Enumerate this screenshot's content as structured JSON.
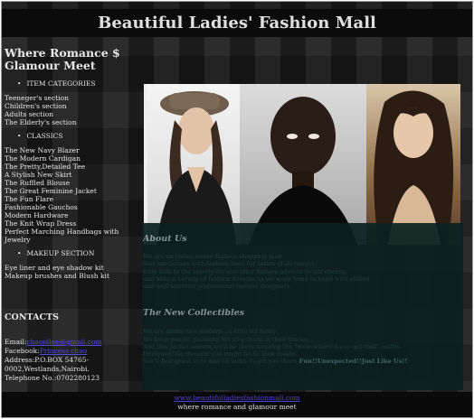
{
  "header": {
    "title": "Beautiful Ladies' Fashion Mall"
  },
  "sidebar": {
    "tagline": "Where Romance $ Glamour Meet",
    "item_categories": {
      "title": "ITEM CATEGORIES",
      "items": [
        "Teeneger's section",
        "Children's section",
        "Adults section",
        "The Elderly's section"
      ]
    },
    "classics": {
      "title": "CLASSICS",
      "items": [
        "The New Navy Blazer",
        "The Modern Cardigan",
        "The Pretty,Detailed Tee",
        "A Stylish New Skirt",
        "The Ruffled Blouse",
        "The Great Feminine Jacket",
        "The Fun Flare",
        "Fashionable Gauchos",
        "Modern Hardware",
        "The Knit Wrap Dress",
        "Perfect Marching Handbags with Jewelry"
      ]
    },
    "makeup": {
      "title": "MAKEUP SECTION",
      "items": [
        "Eye liner and eye shadow kit",
        "Makeup brushes and Blush kit"
      ]
    }
  },
  "contacts": {
    "title": "CONTACTS",
    "email_label": "Email:",
    "email_value": "chaoollee@gmail.com",
    "facebook_label": "Facebook:",
    "facebook_value": "Princess chao",
    "address": "Address:P.O.BOX 54765-0002,Westlands,Nairobi.",
    "telephone": "Telephone No.:0702280123"
  },
  "about": {
    "title": "About Us",
    "lines": [
      "We are an online based fashion shopping mall",
      "that specialises with fashion lines for ladies of all ranges,",
      "from kids to the elderly.We also offer fashion advices to our clients,",
      "and have a variety of fashion designs as we work hand in hand with skilled",
      "and well talented professional fashion designers."
    ]
  },
  "collectibles": {
    "title": "The New Collectibles",
    "lines": [
      "We are distinctive,modern...a little bit feisty.",
      "We keep people guessing.We stop them in their tracks.",
      "And this Jacket season,we'll be there wearing the \"wow-where'd-you-get-that\" outfits.",
      "Intrigued?We thought you might be.So look inside."
    ],
    "final_line_prefix": "You'll find great style and all looks to get you there.",
    "final_line_highlight": "Fun!!Unexpected!!Just Like Us!!"
  },
  "footer": {
    "link": "www.beautifulladiesfashionmall.com",
    "tagline": "where romance and glamour meet"
  }
}
